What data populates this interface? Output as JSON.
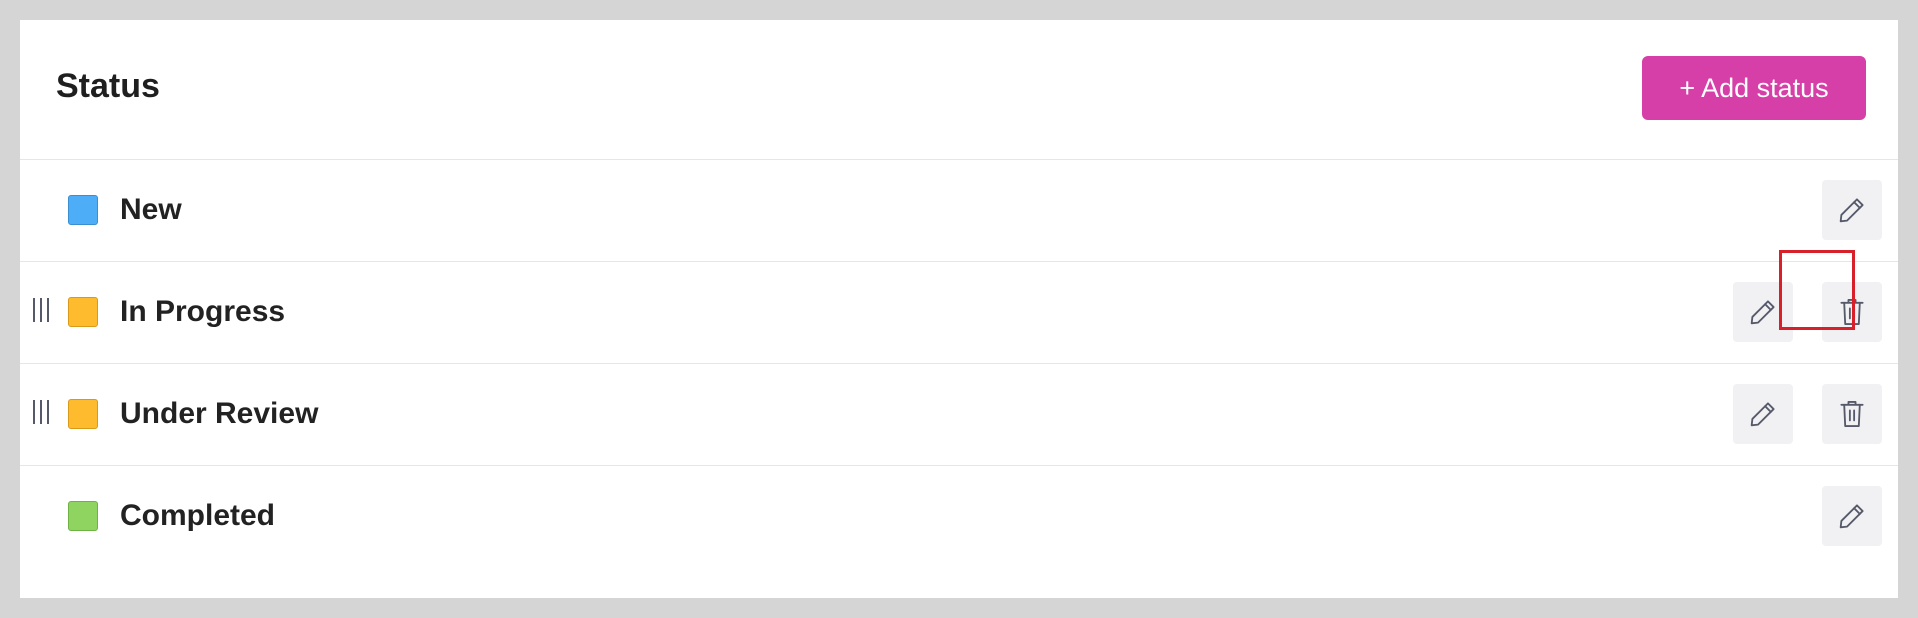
{
  "header": {
    "title": "Status",
    "add_button_label": "+ Add status"
  },
  "statuses": [
    {
      "name": "New",
      "color": "#4daef7",
      "border": "#3a8fd0",
      "draggable": false,
      "deletable": false
    },
    {
      "name": "In Progress",
      "color": "#fdbb2d",
      "border": "#d89a18",
      "draggable": true,
      "deletable": true
    },
    {
      "name": "Under Review",
      "color": "#fdbb2d",
      "border": "#d89a18",
      "draggable": true,
      "deletable": true
    },
    {
      "name": "Completed",
      "color": "#8fd361",
      "border": "#6eb244",
      "draggable": false,
      "deletable": false
    }
  ],
  "icons": {
    "edit": "pencil-icon",
    "delete": "trash-icon",
    "drag": "drag-handle-icon"
  },
  "colors": {
    "accent": "#d63fa8",
    "highlight": "#d8202a",
    "icon_stroke": "#55596a"
  }
}
